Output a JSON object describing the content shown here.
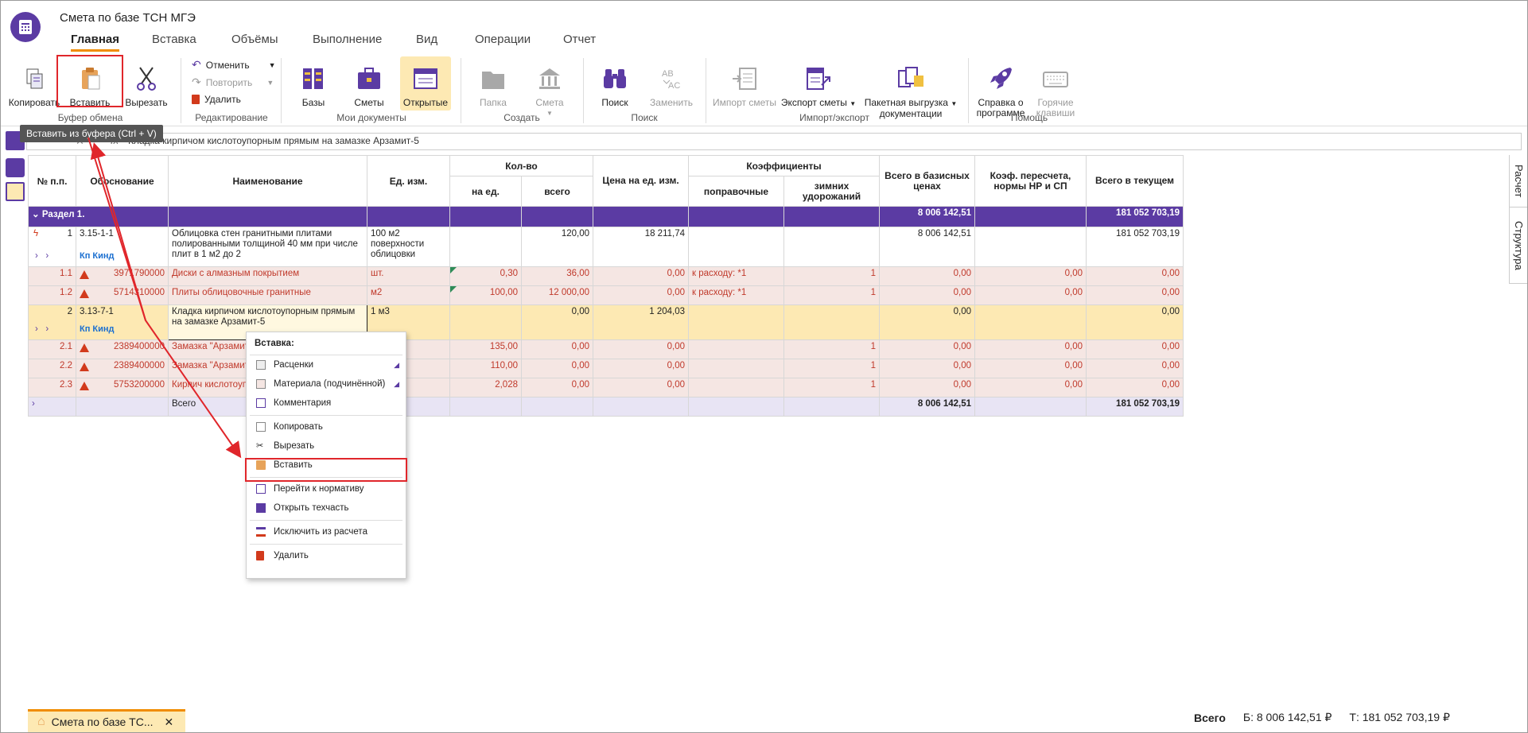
{
  "app": {
    "title": "Смета по базе ТСН МГЭ"
  },
  "tabs": [
    "Главная",
    "Вставка",
    "Объёмы",
    "Выполнение",
    "Вид",
    "Операции",
    "Отчет"
  ],
  "ribbon": {
    "copy": "Копировать",
    "paste": "Вставить",
    "cut": "Вырезать",
    "undo": "Отменить",
    "redo": "Повторить",
    "delete": "Удалить",
    "bases": "Базы",
    "estimates": "Сметы",
    "opened": "Открытые",
    "folder": "Папка",
    "estimate": "Смета",
    "search": "Поиск",
    "replace": "Заменить",
    "import": "Импорт сметы",
    "export": "Экспорт сметы",
    "batch1": "Пакетная выгрузка",
    "batch2": "документации",
    "about1": "Справка о",
    "about2": "программе",
    "hot1": "Горячие",
    "hot2": "клавиши",
    "groups": {
      "clipboard": "Буфер обмена",
      "edit": "Редактирование",
      "docs": "Мои документы",
      "create": "Создать",
      "search": "Поиск",
      "io": "Импорт/экспорт",
      "help": "Помощь"
    }
  },
  "tooltip": "Вставить из буфера (Ctrl + V)",
  "formula_bar": {
    "text": "Кладка кирпичом кислотоупорным прямым на замазке Арзамит-5"
  },
  "table": {
    "headers": {
      "num": "№ п.п.",
      "basis": "Обоснование",
      "name": "Наименование",
      "unit": "Ед. изм.",
      "qty": "Кол-во",
      "per_unit": "на ед.",
      "total": "всего",
      "price": "Цена на ед. изм.",
      "coefs": "Коэффициенты",
      "corr": "поправочные",
      "winter": "зимних удорожаний",
      "base_total": "Всего в базисных ценах",
      "recalc": "Коэф. пересчета, нормы НР и СП",
      "current_total": "Всего в текущем"
    },
    "section": {
      "label": "Раздел 1.",
      "base": "8 006 142,51",
      "current": "181 052 703,19"
    },
    "row1": {
      "num": "1",
      "code": "3.15-1-1",
      "name": "Облицовка стен гранитными плитами полированными толщиной 40 мм при числе плит в 1 м2 до 2",
      "unit": "100 м2 поверхности облицовки",
      "total": "120,00",
      "price": "18 211,74",
      "base": "8 006 142,51",
      "current": "181 052 703,19",
      "k": "Кп Кинд"
    },
    "res1": [
      {
        "num": "1.1",
        "code": "3971790000",
        "name": "Диски с алмазным покрытием",
        "unit": "шт.",
        "per": "0,30",
        "total": "36,00",
        "price": "0,00",
        "corr": "к расходу: *1",
        "winter": "1",
        "base": "0,00",
        "recalc": "0,00",
        "current": "0,00"
      },
      {
        "num": "1.2",
        "code": "5714310000",
        "name": "Плиты облицовочные гранитные",
        "unit": "м2",
        "per": "100,00",
        "total": "12 000,00",
        "price": "0,00",
        "corr": "к расходу: *1",
        "winter": "1",
        "base": "0,00",
        "recalc": "0,00",
        "current": "0,00"
      }
    ],
    "row2": {
      "num": "2",
      "code": "3.13-7-1",
      "name": "Кладка кирпичом кислотоупорным прямым на замазке Арзамит-5",
      "unit": "1 м3",
      "total": "0,00",
      "price": "1 204,03",
      "base": "0,00",
      "current": "0,00",
      "k": "Кп Кинд"
    },
    "res2": [
      {
        "num": "2.1",
        "code": "2389400000",
        "name": "Замазка \"Арзамит",
        "per": "135,00",
        "total": "0,00",
        "price": "0,00",
        "winter": "1",
        "base": "0,00",
        "recalc": "0,00",
        "current": "0,00"
      },
      {
        "num": "2.2",
        "code": "2389400000",
        "name": "Замазка \"Арзамит",
        "per": "110,00",
        "total": "0,00",
        "price": "0,00",
        "winter": "1",
        "base": "0,00",
        "recalc": "0,00",
        "current": "0,00"
      },
      {
        "num": "2.3",
        "code": "5753200000",
        "name": "Кирпич кислотоуп",
        "per": "2,028",
        "total": "0,00",
        "price": "0,00",
        "winter": "1",
        "base": "0,00",
        "recalc": "0,00",
        "current": "0,00"
      }
    ],
    "total_row": {
      "label": "Всего",
      "base": "8 006 142,51",
      "current": "181 052 703,19"
    }
  },
  "context_menu": {
    "header": "Вставка:",
    "items": [
      "Расценки",
      "Материала (подчинённой)",
      "Комментария",
      "Копировать",
      "Вырезать",
      "Вставить",
      "Перейти к нормативу",
      "Открыть техчасть",
      "Исключить из расчета",
      "Удалить"
    ]
  },
  "side_tabs": [
    "Расчет",
    "Структура"
  ],
  "doc_tab": "Смета по базе ТС...",
  "status": {
    "label": "Всего",
    "base": "Б: 8 006 142,51 ₽",
    "current": "Т: 181 052 703,19 ₽"
  },
  "colors": {
    "accent": "#5b3ba3",
    "highlight": "#fde9b3",
    "resource_row": "#f5e6e3",
    "warning": "#d23a1c",
    "annotation": "#e0262b"
  }
}
